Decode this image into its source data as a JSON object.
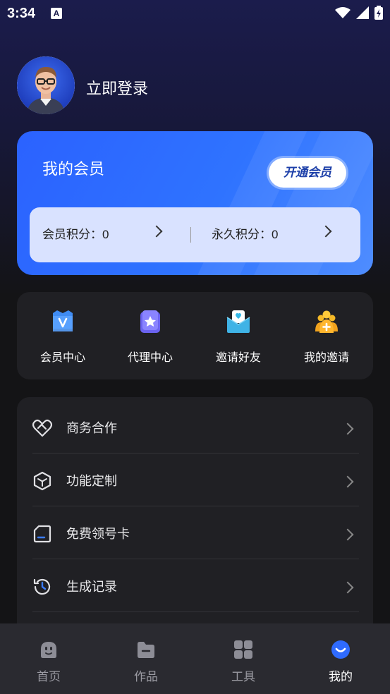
{
  "status_bar": {
    "time": "3:34",
    "notification_glyph": "A"
  },
  "profile": {
    "login_text": "立即登录"
  },
  "member_card": {
    "title": "我的会员",
    "open_button": "开通会员",
    "member_points_label": "会员积分：0",
    "permanent_points_label": "永久积分：0"
  },
  "quick_menu": [
    {
      "label": "会员中心",
      "icon": "vip-shield-icon"
    },
    {
      "label": "代理中心",
      "icon": "star-square-icon"
    },
    {
      "label": "邀请好友",
      "icon": "invite-envelope-icon"
    },
    {
      "label": "我的邀请",
      "icon": "people-add-icon"
    }
  ],
  "list": [
    {
      "label": "商务合作",
      "icon": "handshake-heart-icon"
    },
    {
      "label": "功能定制",
      "icon": "cube-icon"
    },
    {
      "label": "免费领号卡",
      "icon": "sim-card-icon"
    },
    {
      "label": "生成记录",
      "icon": "history-icon"
    }
  ],
  "bottom_nav": [
    {
      "label": "首页",
      "icon": "home-icon"
    },
    {
      "label": "作品",
      "icon": "folder-icon"
    },
    {
      "label": "工具",
      "icon": "grid-icon"
    },
    {
      "label": "我的",
      "icon": "profile-face-icon"
    }
  ],
  "colors": {
    "accent": "#2f6bff",
    "background": "#141416",
    "card": "#202024",
    "nav": "#2a2a30",
    "gold": "#f5b927"
  }
}
